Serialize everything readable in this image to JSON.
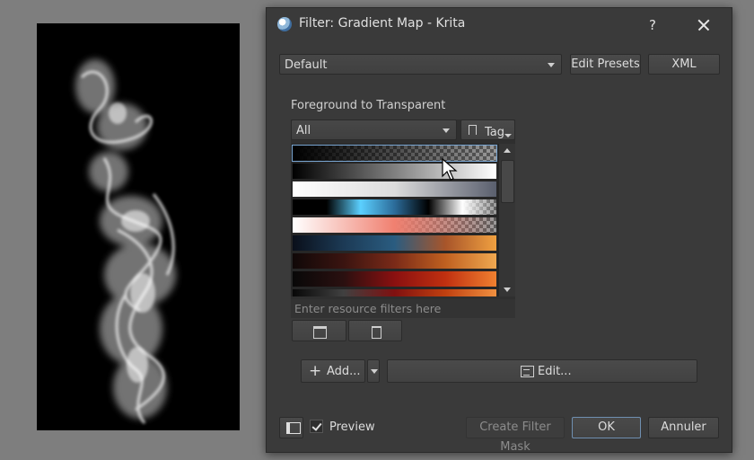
{
  "dialog": {
    "title": "Filter: Gradient Map - Krita",
    "help_label": "?",
    "preset": "Default",
    "edit_presets_label": "Edit Presets",
    "xml_label": "XML",
    "gradient_name": "Foreground to Transparent",
    "tag_filter": "All",
    "tag_button_label": "Tag",
    "filter_placeholder": "Enter resource filters here",
    "add_label": "Add...",
    "add_plus": "+",
    "edit_label": "Edit...",
    "preview_label": "Preview",
    "preview_checked": true,
    "create_mask_label": "Create Filter Mask",
    "ok_label": "OK",
    "cancel_label": "Annuler"
  },
  "gradients": [
    {
      "name": "foreground-to-transparent",
      "stops": [
        "#000000",
        "rgba(0,0,0,0)"
      ],
      "transparent": true
    },
    {
      "name": "black-to-white",
      "stops": [
        "#000000",
        "#808080",
        "#ffffff"
      ],
      "transparent": false
    },
    {
      "name": "white-to-gray",
      "stops": [
        "#ffffff",
        "#dcdcdc",
        "#5a5f6e"
      ],
      "transparent": false
    },
    {
      "name": "black-blue-transparent",
      "stops": [
        "#000000",
        "#000000",
        "#5bd0ff",
        "#2c6c9a",
        "#000000",
        "#ffffff",
        "rgba(255,255,255,0)"
      ],
      "transparent": true
    },
    {
      "name": "white-salmon-transparent",
      "stops": [
        "#ffffff",
        "#f08070",
        "rgba(240,128,112,0)"
      ],
      "transparent": true
    },
    {
      "name": "navy-teal-orange",
      "stops": [
        "#0a0f1a",
        "#1c3a55",
        "#2a5c80",
        "#a8552a",
        "#f0a040"
      ],
      "transparent": false
    },
    {
      "name": "dark-red-orange",
      "stops": [
        "#100808",
        "#3a1410",
        "#7a2a18",
        "#c06020",
        "#f0a850"
      ],
      "transparent": false
    },
    {
      "name": "black-red-orange",
      "stops": [
        "#080808",
        "#2a1010",
        "#8a1010",
        "#c03010",
        "#f08030"
      ],
      "transparent": false
    },
    {
      "name": "black-gray-red-orange",
      "stops": [
        "#080808",
        "#404040",
        "#801010",
        "#c04010",
        "#f09040"
      ],
      "transparent": false
    }
  ],
  "icons": {
    "app": "krita-icon",
    "close": "close-icon",
    "bookmark": "bookmark-icon",
    "folder": "folder-icon",
    "trash": "trash-icon",
    "edit": "edit-icon",
    "sidebar": "sidebar-toggle-icon"
  }
}
